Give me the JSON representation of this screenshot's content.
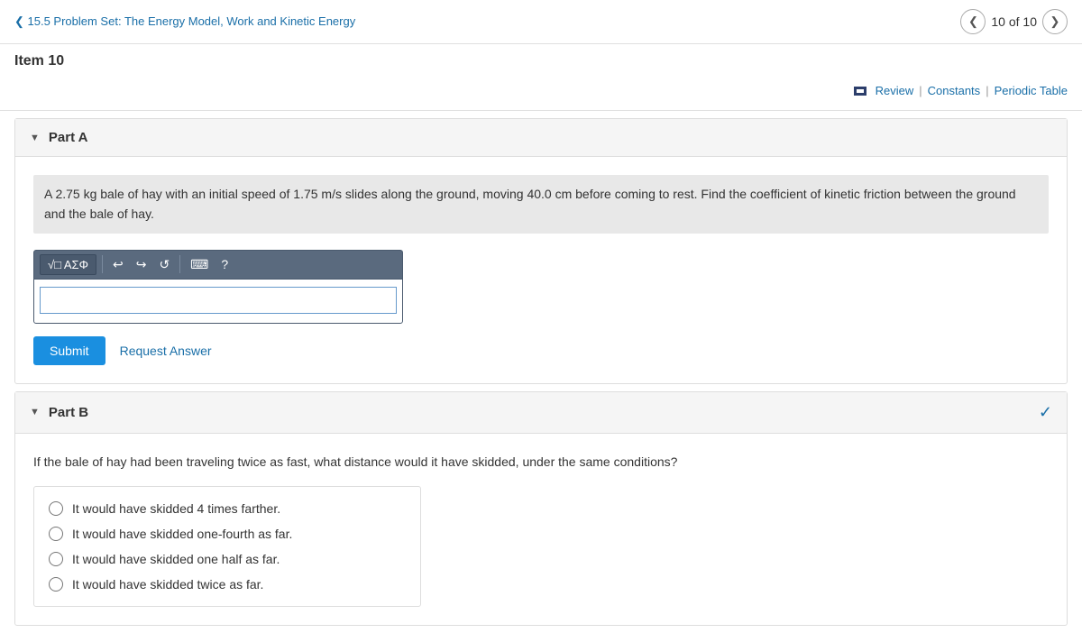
{
  "breadcrumb": {
    "label": "❮ 15.5 Problem Set: The Energy Model, Work and Kinetic Energy"
  },
  "header": {
    "item_label": "Item 10",
    "counter": "10 of 10"
  },
  "resources": {
    "review_label": "Review",
    "constants_label": "Constants",
    "periodic_table_label": "Periodic Table",
    "divider": "|"
  },
  "part_a": {
    "label": "Part A",
    "problem_text": "A 2.75 kg bale of hay with an initial speed of 1.75 m/s slides along the ground, moving 40.0 cm before coming to rest. Find the coefficient of kinetic friction between the ground and the bale of hay.",
    "toolbar": {
      "math_btn": "√□ ΑΣΦ",
      "undo_symbol": "↩",
      "redo_symbol": "↪",
      "reset_symbol": "↺",
      "keyboard_symbol": "⌨",
      "help_symbol": "?"
    },
    "input_placeholder": "",
    "submit_label": "Submit",
    "request_answer_label": "Request Answer"
  },
  "part_b": {
    "label": "Part B",
    "check_symbol": "✓",
    "question_text": "If the bale of hay had been traveling twice as fast, what distance would it have skidded, under the same conditions?",
    "options": [
      {
        "id": "opt1",
        "text": "It would have skidded 4 times farther."
      },
      {
        "id": "opt2",
        "text": "It would have skidded one-fourth as far."
      },
      {
        "id": "opt3",
        "text": "It would have skidded one half as far."
      },
      {
        "id": "opt4",
        "text": "It would have skidded twice as far."
      }
    ]
  },
  "icons": {
    "chevron_down": "▼",
    "chevron_left": "❮",
    "chevron_right": "❯"
  }
}
